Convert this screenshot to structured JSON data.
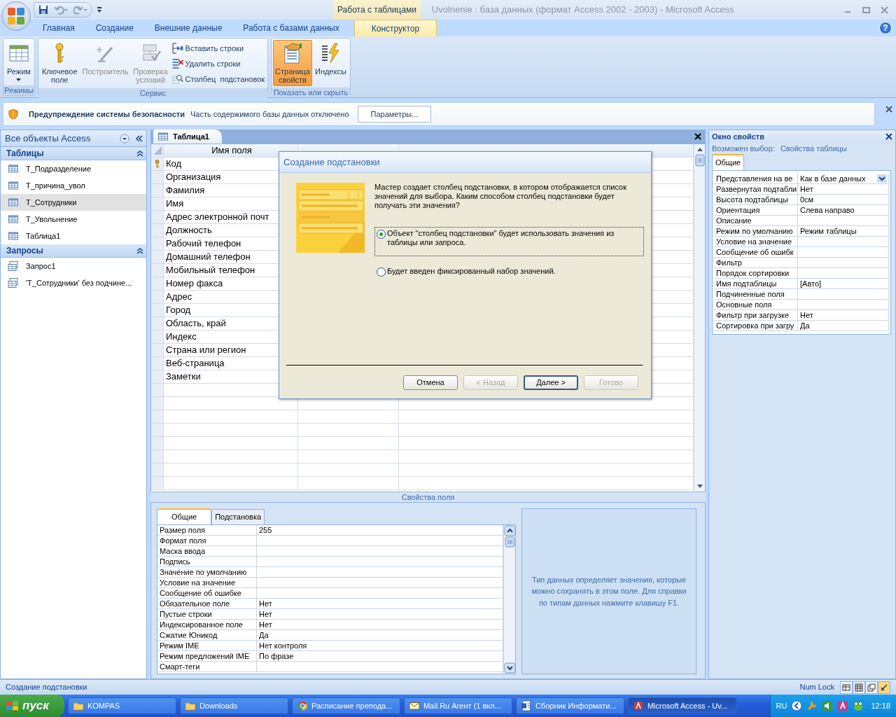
{
  "window": {
    "title": "Uvolnenie : база данных (формат Access 2002 - 2003) - Microsoft Access",
    "context_group": "Работа с таблицами",
    "help": "?"
  },
  "ribbon_tabs": [
    {
      "label": "Главная",
      "selected": false
    },
    {
      "label": "Создание",
      "selected": false
    },
    {
      "label": "Внешние данные",
      "selected": false
    },
    {
      "label": "Работа с базами данных",
      "selected": false
    },
    {
      "label": "Конструктор",
      "selected": true
    }
  ],
  "ribbon_groups": [
    {
      "title": "Режимы",
      "buttons": [
        {
          "label": "Режим",
          "kind": "menu",
          "disabled": false,
          "pressed": false
        }
      ]
    },
    {
      "title": "Сервис",
      "buttons": [
        {
          "label": "Ключевое\nполе",
          "kind": "large",
          "disabled": false,
          "pressed": false
        },
        {
          "label": "Построитель",
          "kind": "large",
          "disabled": true,
          "pressed": false
        },
        {
          "label": "Проверка\nусловий",
          "kind": "large",
          "disabled": true,
          "pressed": false
        },
        {
          "label": "Вставить строки",
          "kind": "small",
          "disabled": false,
          "pressed": false
        },
        {
          "label": "Удалить строки",
          "kind": "small",
          "disabled": false,
          "pressed": false
        },
        {
          "label": "Столбец  подстановок",
          "kind": "small",
          "disabled": false,
          "pressed": false
        }
      ]
    },
    {
      "title": "Показать или скрыть",
      "buttons": [
        {
          "label": "Страница\nсвойств",
          "kind": "large",
          "disabled": false,
          "pressed": true
        },
        {
          "label": "Индексы",
          "kind": "large",
          "disabled": false,
          "pressed": false
        }
      ]
    }
  ],
  "security_bar": {
    "title": "Предупреждение системы безопасности",
    "message": "Часть содержимого базы данных отключено",
    "button": "Параметры..."
  },
  "navigation": {
    "header": "Все объекты Access",
    "groups": [
      {
        "title": "Таблицы",
        "items": [
          {
            "label": "T_Подразделение",
            "selected": false
          },
          {
            "label": "T_причина_увол",
            "selected": false
          },
          {
            "label": "T_Сотрудники",
            "selected": true
          },
          {
            "label": "T_Увольнение",
            "selected": false
          },
          {
            "label": "Таблица1",
            "selected": false
          }
        ]
      },
      {
        "title": "Запросы",
        "items": [
          {
            "label": "Запрос1",
            "selected": false
          },
          {
            "label": "'T_Сотрудники' без подчине...",
            "selected": false
          }
        ]
      }
    ]
  },
  "document_tab": "Таблица1",
  "design_grid": {
    "columns": [
      "Имя поля"
    ],
    "rows": [
      {
        "field": "Код",
        "primary_key": true
      },
      {
        "field": "Организация",
        "primary_key": false
      },
      {
        "field": "Фамилия",
        "primary_key": false
      },
      {
        "field": "Имя",
        "primary_key": false
      },
      {
        "field": "Адрес электронной почт",
        "primary_key": false
      },
      {
        "field": "Должность",
        "primary_key": false
      },
      {
        "field": "Рабочий телефон",
        "primary_key": false
      },
      {
        "field": "Домашний телефон",
        "primary_key": false
      },
      {
        "field": "Мобильный телефон",
        "primary_key": false
      },
      {
        "field": "Номер факса",
        "primary_key": false
      },
      {
        "field": "Адрес",
        "primary_key": false
      },
      {
        "field": "Город",
        "primary_key": false
      },
      {
        "field": "Область, край",
        "primary_key": false
      },
      {
        "field": "Индекс",
        "primary_key": false
      },
      {
        "field": "Страна или регион",
        "primary_key": false
      },
      {
        "field": "Веб-страница",
        "primary_key": false
      },
      {
        "field": "Заметки",
        "primary_key": false
      }
    ]
  },
  "field_properties": {
    "caption": "Свойства поля",
    "tabs": [
      {
        "label": "Общие",
        "selected": true
      },
      {
        "label": "Подстановка",
        "selected": false
      }
    ],
    "rows": [
      {
        "name": "Размер поля",
        "value": "255"
      },
      {
        "name": "Формат поля"
      },
      {
        "name": "Маска ввода"
      },
      {
        "name": "Подпись"
      },
      {
        "name": "Значение по умолчанию"
      },
      {
        "name": "Условие на значение"
      },
      {
        "name": "Сообщение об ошибке"
      },
      {
        "name": "Обязательное поле",
        "value": "Нет"
      },
      {
        "name": "Пустые строки",
        "value": "Нет"
      },
      {
        "name": "Индексированное поле",
        "value": "Нет"
      },
      {
        "name": "Сжатие Юникод",
        "value": "Да"
      },
      {
        "name": "Режим IME",
        "value": "Нет контроля"
      },
      {
        "name": "Режим предложений IME",
        "value": "По фразе"
      },
      {
        "name": "Смарт-теги"
      }
    ],
    "help_text": "Тип данных определяет значения, которые можно сохранять в этом поле.  Для справки по типам данных нажмите клавишу F1."
  },
  "dialog": {
    "title": "Создание подстановки",
    "text": "Мастер создает столбец подстановки, в котором отображается список значений для выбора.  Каким способом столбец подстановки будет получать эти значения?",
    "options": [
      {
        "label": "Объект \"столбец подстановки\" будет использовать значения из таблицы или запроса.",
        "selected": true
      },
      {
        "label": "Будет введен фиксированный набор значений.",
        "selected": false
      }
    ],
    "buttons": [
      {
        "label": "Отмена",
        "disabled": false,
        "default": false
      },
      {
        "label": "< Назад",
        "disabled": true,
        "default": false
      },
      {
        "label": "Далее >",
        "disabled": false,
        "default": true
      },
      {
        "label": "Готово",
        "disabled": true,
        "default": false
      }
    ]
  },
  "property_sheet": {
    "title": "Окно свойств",
    "selection_label": "Возможен выбор:",
    "selection": "Свойства таблицы",
    "tabs": [
      {
        "label": "Общие",
        "selected": true
      }
    ],
    "rows": [
      {
        "name": "Представления на ве",
        "value": "Как в базе данных",
        "kind": "combo"
      },
      {
        "name": "Развернутая подтабли",
        "value": "Нет",
        "kind": "text"
      },
      {
        "name": "Высота подтаблицы",
        "value": "0см",
        "kind": "text"
      },
      {
        "name": "Ориентация",
        "value": "Слева направо",
        "kind": "text"
      },
      {
        "name": "Описание",
        "kind": "text"
      },
      {
        "name": "Режим по умолчанию",
        "value": "Режим таблицы",
        "kind": "text"
      },
      {
        "name": "Условие на значение",
        "kind": "text"
      },
      {
        "name": "Сообщение об ошибк",
        "kind": "text"
      },
      {
        "name": "Фильтр",
        "kind": "text"
      },
      {
        "name": "Порядок сортировки",
        "kind": "text"
      },
      {
        "name": "Имя подтаблицы",
        "value": "[Авто]",
        "kind": "text"
      },
      {
        "name": "Подчиненные поля",
        "kind": "text"
      },
      {
        "name": "Основные поля",
        "kind": "text"
      },
      {
        "name": "Фильтр при загрузке",
        "value": "Нет",
        "kind": "text"
      },
      {
        "name": "Сортировка при загру",
        "value": "Да",
        "kind": "text"
      }
    ]
  },
  "status_bar": {
    "text": "Создание подстановки",
    "num_lock": "Num Lock"
  },
  "taskbar": {
    "start": "пуск",
    "items": [
      {
        "label": "KOMPAS",
        "selected": false
      },
      {
        "label": "Downloads",
        "selected": false
      },
      {
        "label": "Расписание препода...",
        "selected": false
      },
      {
        "label": "Mail.Ru Агент (1 вкл...",
        "selected": false
      },
      {
        "label": "Сборник Информати...",
        "selected": false
      },
      {
        "label": "Microsoft Access - Uv...",
        "selected": true
      }
    ],
    "language": "RU",
    "clock": "12:18"
  }
}
